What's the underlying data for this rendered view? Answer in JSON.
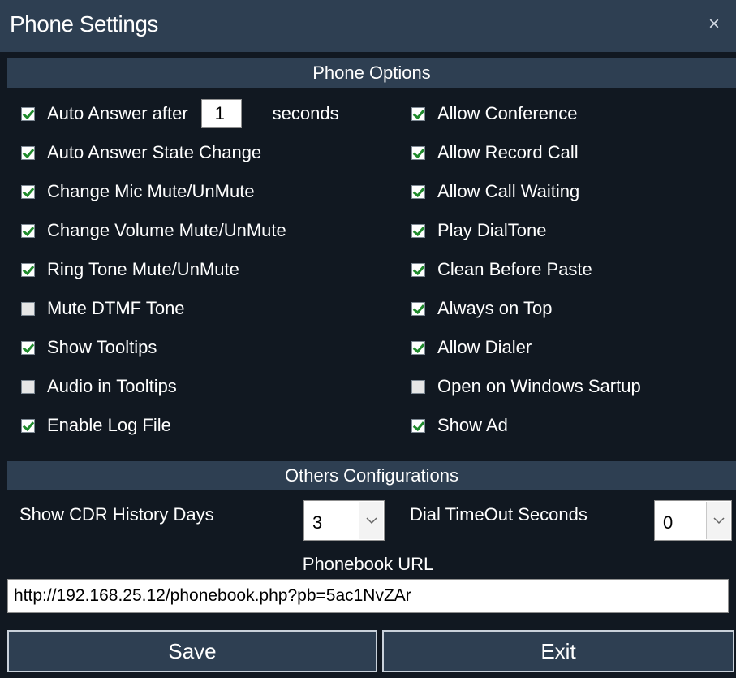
{
  "window": {
    "title": "Phone Settings",
    "close_glyph": "×"
  },
  "phone_options": {
    "header": "Phone Options",
    "auto_answer": {
      "label": "Auto Answer after",
      "value": "1",
      "suffix": "seconds",
      "checked": true
    },
    "left": [
      {
        "label": "Auto Answer State Change",
        "checked": true
      },
      {
        "label": "Change Mic Mute/UnMute",
        "checked": true
      },
      {
        "label": "Change Volume Mute/UnMute",
        "checked": true
      },
      {
        "label": "Ring Tone Mute/UnMute",
        "checked": true
      },
      {
        "label": "Mute DTMF Tone",
        "checked": false
      },
      {
        "label": "Show Tooltips",
        "checked": true
      },
      {
        "label": "Audio in Tooltips",
        "checked": false
      },
      {
        "label": "Enable Log File",
        "checked": true
      }
    ],
    "right": [
      {
        "label": "Allow Conference",
        "checked": true
      },
      {
        "label": "Allow Record Call",
        "checked": true
      },
      {
        "label": "Allow Call Waiting",
        "checked": true
      },
      {
        "label": "Play DialTone",
        "checked": true
      },
      {
        "label": "Clean Before Paste",
        "checked": true
      },
      {
        "label": "Always on Top",
        "checked": true
      },
      {
        "label": "Allow Dialer",
        "checked": true
      },
      {
        "label": "Open on Windows Sartup",
        "checked": false
      },
      {
        "label": "Show Ad",
        "checked": true
      }
    ]
  },
  "others": {
    "header": "Others Configurations",
    "cdr_label": "Show CDR History Days",
    "cdr_value": "3",
    "dial_label": "Dial TimeOut Seconds",
    "dial_value": "0",
    "phonebook_label": "Phonebook URL",
    "phonebook_url": "http://192.168.25.12/phonebook.php?pb=5ac1NvZAr"
  },
  "buttons": {
    "save": "Save",
    "exit": "Exit"
  },
  "icons": {
    "dropdown": "chevron-down-icon",
    "check": "check-icon"
  },
  "colors": {
    "background": "#111821",
    "header": "#2e3f52",
    "check": "#1f8a2c"
  }
}
